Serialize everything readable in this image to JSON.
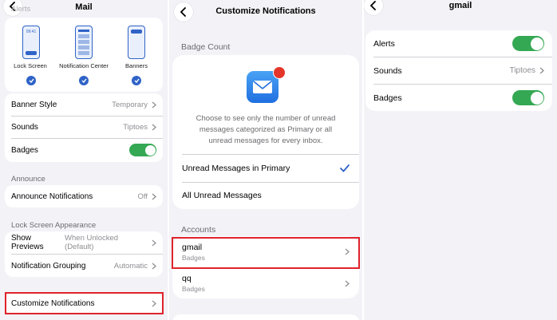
{
  "panel1": {
    "title": "Mail",
    "cut_header": "Alerts",
    "phone_options": [
      {
        "label": "Lock Screen",
        "time": "09:41"
      },
      {
        "label": "Notification Center"
      },
      {
        "label": "Banners"
      }
    ],
    "alerts_rows": [
      {
        "label": "Banner Style",
        "value": "Temporary"
      },
      {
        "label": "Sounds",
        "value": "Tiptoes"
      },
      {
        "label": "Badges"
      }
    ],
    "announce_header": "Announce",
    "announce_row": {
      "label": "Announce Notifications",
      "value": "Off"
    },
    "lock_header": "Lock Screen Appearance",
    "lock_rows": [
      {
        "label": "Show Previews",
        "value": "When Unlocked (Default)"
      },
      {
        "label": "Notification Grouping",
        "value": "Automatic"
      }
    ],
    "customize_label": "Customize Notifications"
  },
  "panel2": {
    "title": "Customize Notifications",
    "badge_header": "Badge Count",
    "badge_description": "Choose to see only the number of unread messages categorized as Primary or all unread messages for every inbox.",
    "options": [
      "Unread Messages in Primary",
      "All Unread Messages"
    ],
    "accounts_header": "Accounts",
    "accounts": [
      {
        "name": "gmail",
        "subtitle": "Badges"
      },
      {
        "name": "qq",
        "subtitle": "Badges"
      }
    ]
  },
  "panel3": {
    "title": "gmail",
    "rows": [
      {
        "label": "Alerts"
      },
      {
        "label": "Sounds",
        "value": "Tiptoes"
      },
      {
        "label": "Badges"
      }
    ]
  },
  "colors": {
    "accent": "#2f63c7",
    "toggle_on": "#34a853",
    "highlight": "#e0232b",
    "background": "#f2f2f7",
    "badge_red": "#e5352b"
  },
  "icons": [
    "back-chevron-icon",
    "chevron-right-icon",
    "checkmark-icon",
    "mail-app-icon"
  ]
}
